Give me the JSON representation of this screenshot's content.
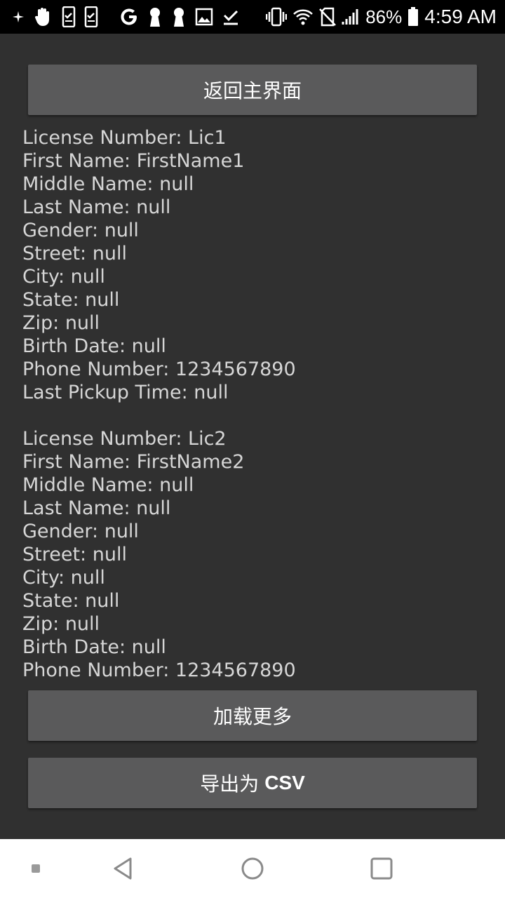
{
  "status_bar": {
    "battery_percent": "86%",
    "time": "4:59 AM",
    "left_icons": [
      "sparkle-icon",
      "hand-icon",
      "phone-check-icon",
      "phone-check-icon",
      "google-icon",
      "keyhole-icon",
      "keyhole-icon",
      "image-icon",
      "download-done-icon"
    ],
    "right_icons": [
      "vibrate-icon",
      "wifi-icon",
      "no-sim-icon",
      "signal-icon",
      "battery-icon"
    ]
  },
  "buttons": {
    "back": "返回主界面",
    "load_more": "加载更多",
    "export_prefix": "导出为",
    "export_suffix": "CSV"
  },
  "records": [
    [
      "License Number: Lic1",
      "First Name: FirstName1",
      "Middle Name: null",
      "Last Name: null",
      "Gender: null",
      "Street: null",
      "City: null",
      "State: null",
      "Zip: null",
      "Birth Date: null",
      "Phone Number: 1234567890",
      "Last Pickup Time: null"
    ],
    [
      "License Number: Lic2",
      "First Name: FirstName2",
      "Middle Name: null",
      "Last Name: null",
      "Gender: null",
      "Street: null",
      "City: null",
      "State: null",
      "Zip: null",
      "Birth Date: null",
      "Phone Number: 1234567890"
    ]
  ],
  "nav_bar": {
    "items": [
      "dot-icon",
      "back-triangle-icon",
      "home-circle-icon",
      "recents-square-icon"
    ]
  },
  "colors": {
    "background": "#303030",
    "button": "#5a5a5b",
    "text": "#d6d6d6",
    "status_bar": "#000000",
    "nav_bar": "#ffffff"
  }
}
